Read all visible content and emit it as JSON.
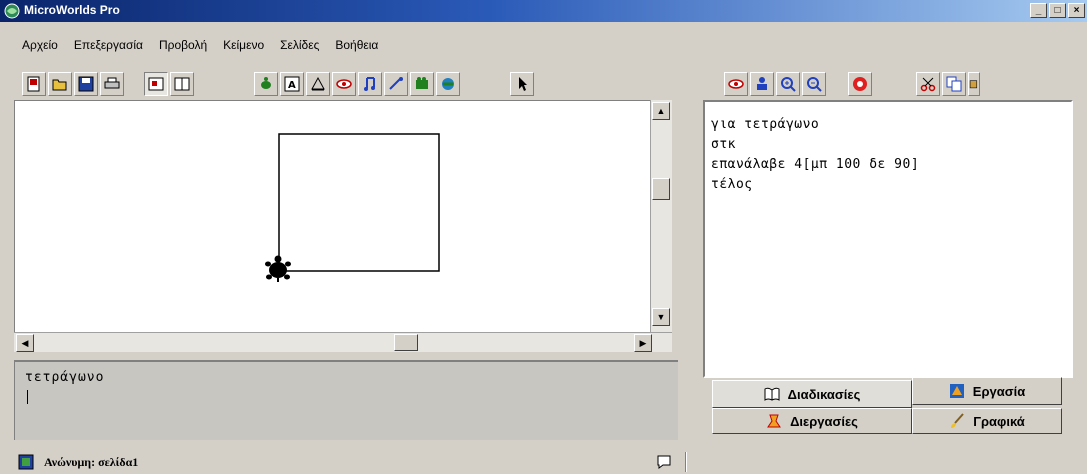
{
  "window": {
    "title": "MicroWorlds Pro",
    "minimize_label": "_",
    "maximize_label": "□",
    "close_label": "×"
  },
  "menu": [
    "Αρχείο",
    "Επεξεργασία",
    "Προβολή",
    "Κείμενο",
    "Σελίδες",
    "Βοήθεια"
  ],
  "toolbar_left_icons": [
    "new-page-icon",
    "open-icon",
    "save-icon",
    "print-icon"
  ],
  "toolbar_view_icons": [
    "graphics-view-icon",
    "split-view-icon"
  ],
  "toolbar_tools_icons": [
    "hatch-turtle-icon",
    "text-box-icon",
    "button-icon",
    "slider-icon",
    "melody-icon",
    "sound-icon",
    "video-icon",
    "record-icon"
  ],
  "toolbar_pointer_icon": "pointer-icon",
  "toolbar_right_icons": [
    "eye-icon",
    "stamp-icon",
    "zoom-in-icon",
    "zoom-out-icon",
    "stop-icon"
  ],
  "toolbar_edit_icons": [
    "cut-icon",
    "copy-icon",
    "paste-icon"
  ],
  "command_center": {
    "text": "τετράγωνο"
  },
  "procedures": {
    "lines": [
      "για τετράγωνο",
      "στκ",
      "επανάλαβε 4[μπ 100 δε 90]",
      "τέλος"
    ]
  },
  "tabs": {
    "procedures": "Διαδικασίες",
    "project": "Εργασία",
    "processes": "Διεργασίες",
    "graphics": "Γραφικά"
  },
  "status": {
    "page": "Ανώνυμη: σελίδα1"
  }
}
